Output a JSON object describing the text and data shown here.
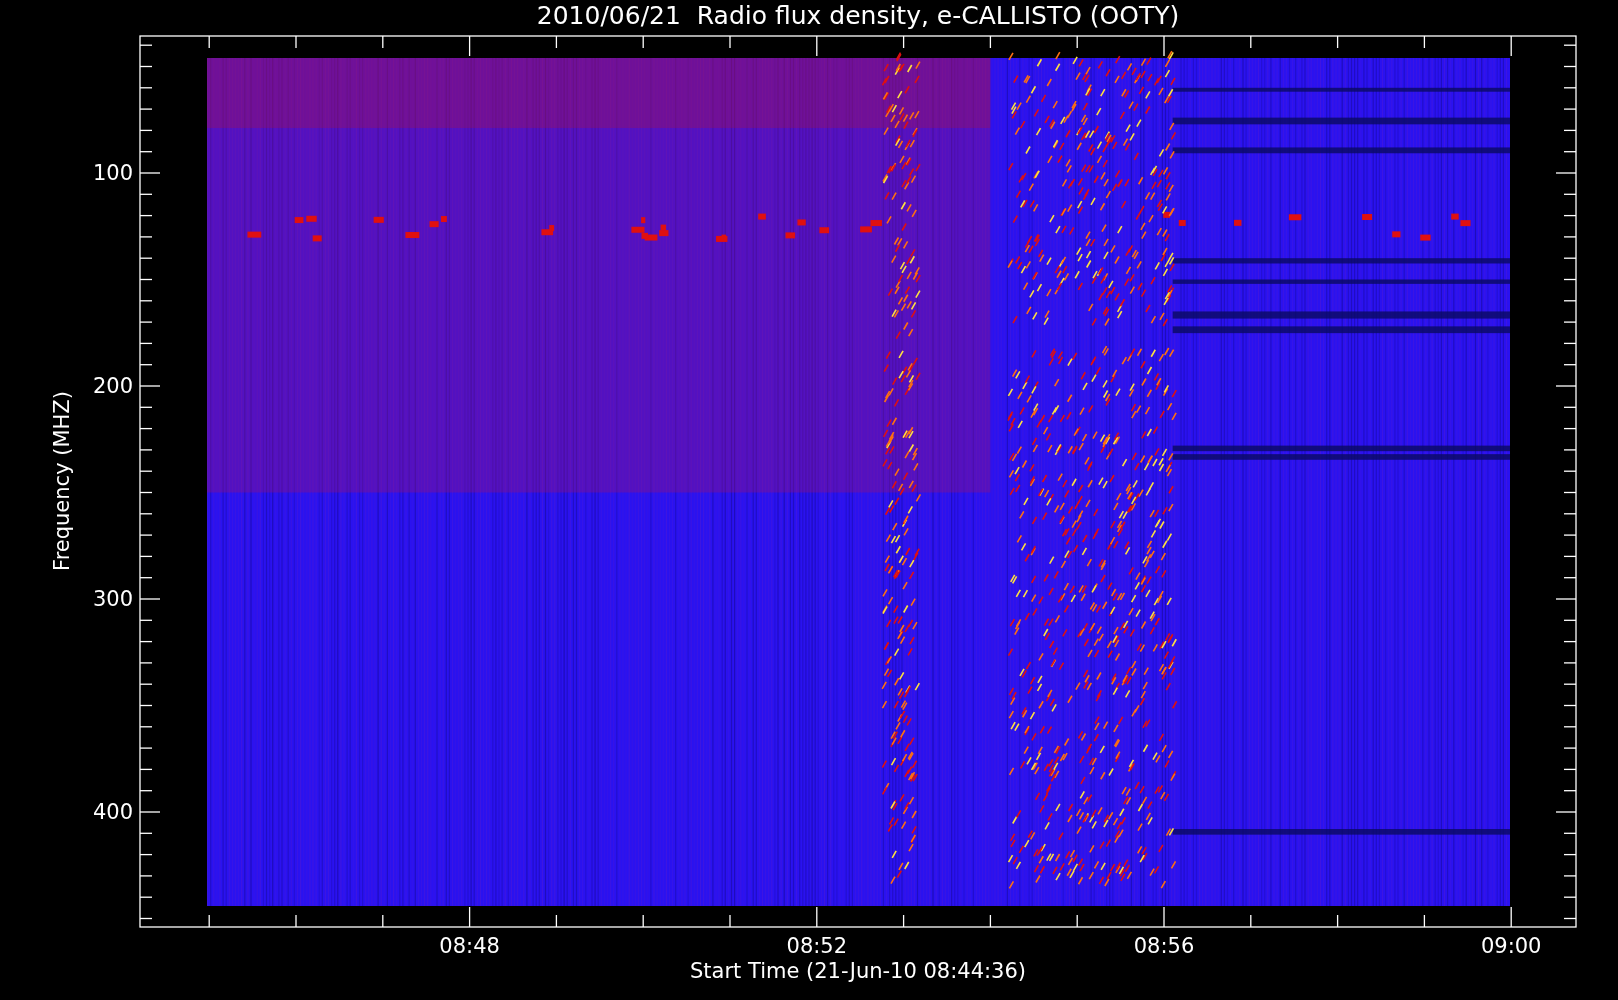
{
  "plot": {
    "title": "2010/06/21  Radio flux density, e-CALLISTO (OOTY)",
    "ylabel": "Frequency (MHZ)",
    "xlabel": "Start Time (21-Jun-10 08:44:36)",
    "yticks": [
      "100",
      "200",
      "300",
      "400"
    ],
    "xticks": [
      "08:48",
      "08:52",
      "08:56",
      "09:00"
    ]
  }
}
